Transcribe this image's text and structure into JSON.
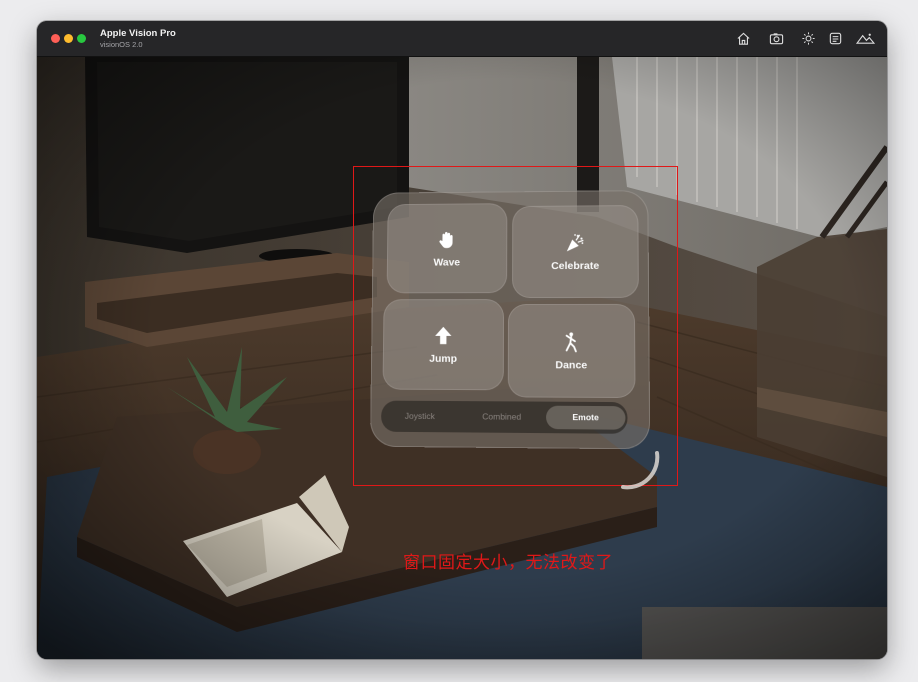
{
  "window": {
    "title": "Apple Vision Pro",
    "subtitle": "visionOS 2.0",
    "traffic_lights": [
      "close",
      "minimize",
      "zoom"
    ],
    "toolbar_icons": [
      "home-icon",
      "screenshot-icon",
      "brightness-icon",
      "device-icon",
      "environment-icon"
    ]
  },
  "panel": {
    "buttons": [
      {
        "label": "Wave",
        "icon": "hand-wave-icon"
      },
      {
        "label": "Celebrate",
        "icon": "party-popper-icon"
      },
      {
        "label": "Jump",
        "icon": "arrow-up-icon"
      },
      {
        "label": "Dance",
        "icon": "figure-dance-icon"
      }
    ],
    "tabs": [
      {
        "label": "Joystick",
        "selected": false
      },
      {
        "label": "Combined",
        "selected": false
      },
      {
        "label": "Emote",
        "selected": true
      }
    ]
  },
  "annotation": {
    "text": "窗口固定大小，无法改变了",
    "color": "#e01818"
  },
  "colors": {
    "highlight_border": "#e01818",
    "titlebar": "#262628"
  }
}
